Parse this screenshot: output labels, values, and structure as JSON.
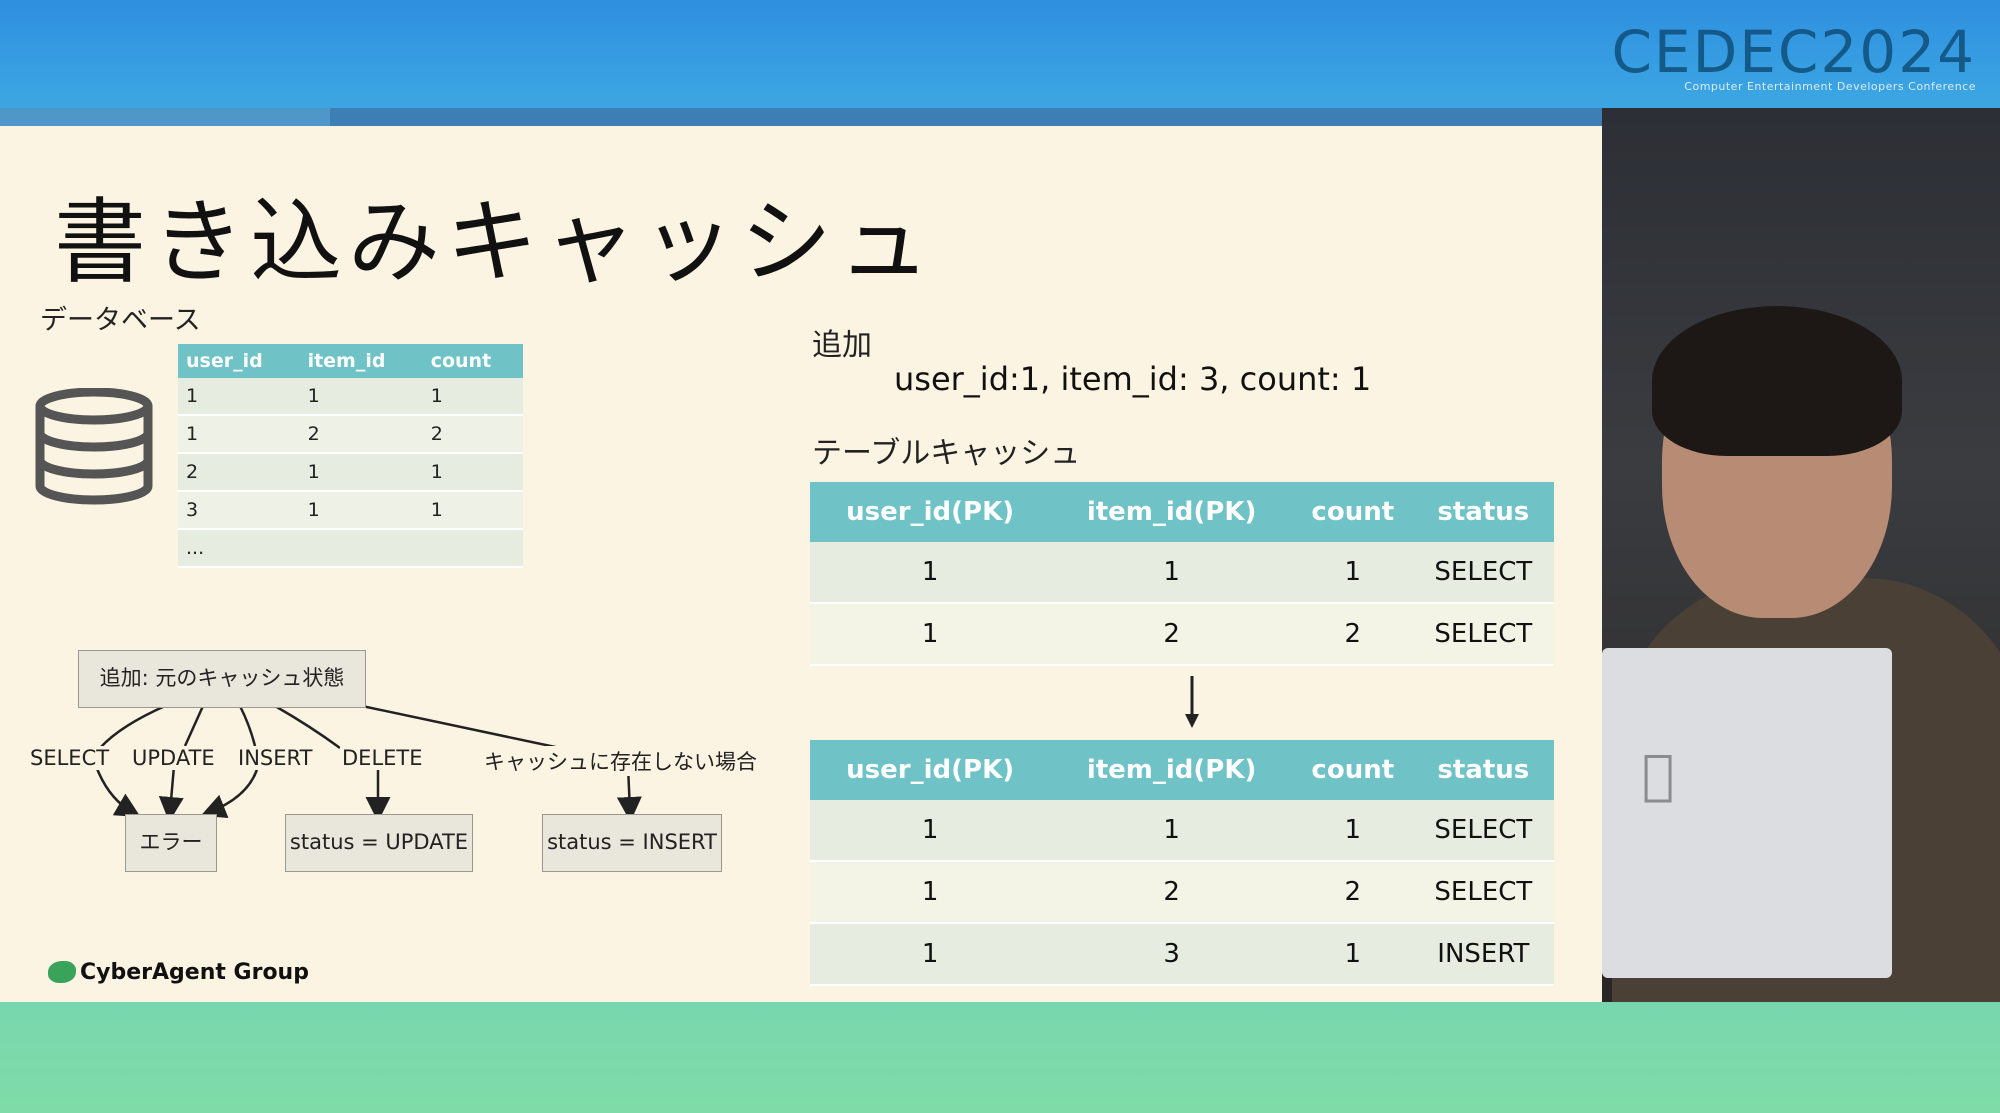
{
  "header": {
    "logo_main": "CEDEC",
    "logo_year": "2024",
    "logo_sub": "Computer Entertainment Developers Conference"
  },
  "slide": {
    "title": "書き込みキャッシュ",
    "database_label": "データベース",
    "db_table": {
      "columns": [
        "user_id",
        "item_id",
        "count"
      ],
      "rows": [
        [
          "1",
          "1",
          "1"
        ],
        [
          "1",
          "2",
          "2"
        ],
        [
          "2",
          "1",
          "1"
        ],
        [
          "3",
          "1",
          "1"
        ],
        [
          "...",
          "",
          ""
        ]
      ]
    },
    "add_label": "追加",
    "add_detail": "user_id:1, item_id: 3, count: 1",
    "table_cache_label": "テーブルキャッシュ",
    "cache_before": {
      "columns": [
        "user_id(PK)",
        "item_id(PK)",
        "count",
        "status"
      ],
      "rows": [
        [
          "1",
          "1",
          "1",
          "SELECT"
        ],
        [
          "1",
          "2",
          "2",
          "SELECT"
        ]
      ]
    },
    "cache_after": {
      "columns": [
        "user_id(PK)",
        "item_id(PK)",
        "count",
        "status"
      ],
      "rows": [
        [
          "1",
          "1",
          "1",
          "SELECT"
        ],
        [
          "1",
          "2",
          "2",
          "SELECT"
        ],
        [
          "1",
          "3",
          "1",
          "INSERT"
        ]
      ]
    },
    "flow": {
      "root": "追加: 元のキャッシュ状態",
      "edges": [
        "SELECT",
        "UPDATE",
        "INSERT",
        "DELETE",
        "キャッシュに存在しない場合"
      ],
      "result_error": "エラー",
      "result_update": "status = UPDATE",
      "result_insert": "status = INSERT"
    },
    "footer_logo": "CyberAgent Group"
  }
}
